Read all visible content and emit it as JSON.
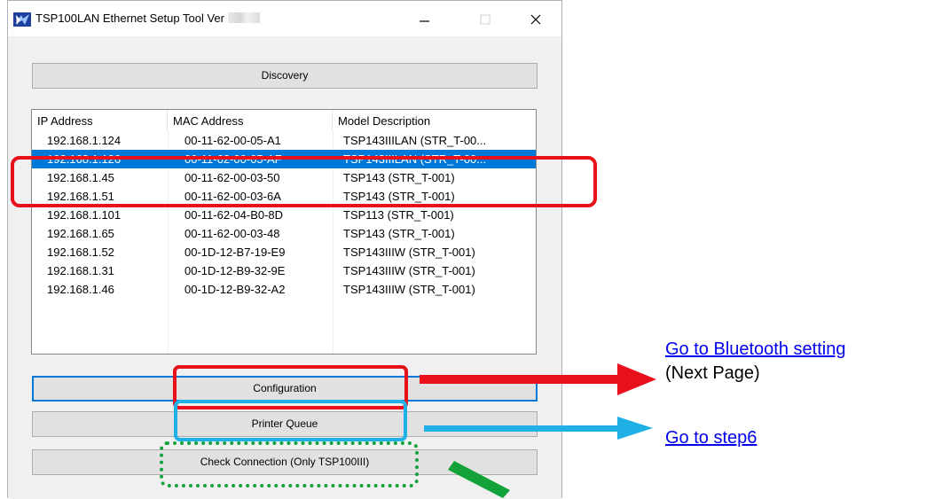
{
  "window": {
    "title": "TSP100LAN Ethernet Setup Tool Ver",
    "controls": {
      "minimize": "—",
      "maximize": "☐",
      "close": "✕"
    }
  },
  "buttons": {
    "discovery": "Discovery",
    "configuration": "Configuration",
    "printer_queue": "Printer Queue",
    "check_connection": "Check Connection (Only TSP100III)"
  },
  "list": {
    "columns": [
      "IP Address",
      "MAC Address",
      "Model Description"
    ],
    "rows": [
      {
        "ip": "192.168.1.124",
        "mac": "00-11-62-00-05-A1",
        "model": "TSP143IIILAN (STR_T-00..."
      },
      {
        "ip": "192.168.1.126",
        "mac": "00-11-62-00-05-AF",
        "model": "TSP143IIILAN (STR_T-00..."
      },
      {
        "ip": "192.168.1.45",
        "mac": "00-11-62-00-03-50",
        "model": "TSP143 (STR_T-001)"
      },
      {
        "ip": "192.168.1.51",
        "mac": "00-11-62-00-03-6A",
        "model": "TSP143 (STR_T-001)"
      },
      {
        "ip": "192.168.1.101",
        "mac": "00-11-62-04-B0-8D",
        "model": "TSP113 (STR_T-001)"
      },
      {
        "ip": "192.168.1.65",
        "mac": "00-11-62-00-03-48",
        "model": "TSP143 (STR_T-001)"
      },
      {
        "ip": "192.168.1.52",
        "mac": "00-1D-12-B7-19-E9",
        "model": "TSP143IIIW (STR_T-001)"
      },
      {
        "ip": "192.168.1.31",
        "mac": "00-1D-12-B9-32-9E",
        "model": "TSP143IIIW (STR_T-001)"
      },
      {
        "ip": "192.168.1.46",
        "mac": "00-1D-12-B9-32-A2",
        "model": "TSP143IIIW (STR_T-001)"
      }
    ]
  },
  "annotations": {
    "bluetooth_link": "Go to Bluetooth setting",
    "next_page": "(Next Page)",
    "step6_link": "Go to step6",
    "colors": {
      "red": "#e8101a",
      "blue": "#1fb0e6",
      "green": "#13a23a",
      "selection": "#0078d7"
    }
  }
}
